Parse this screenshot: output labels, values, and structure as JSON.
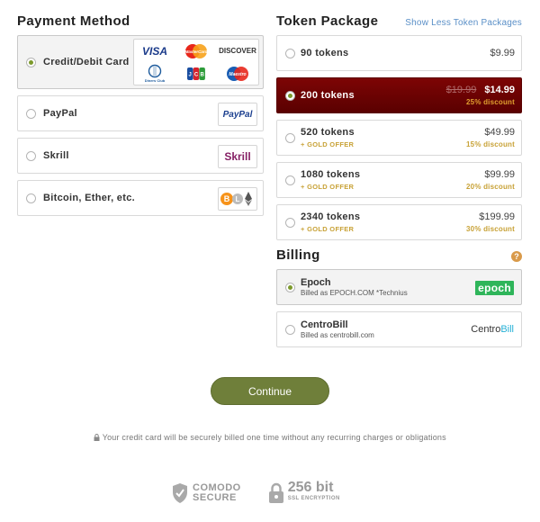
{
  "payment": {
    "title": "Payment Method",
    "methods": [
      {
        "label": "Credit/Debit Card",
        "selected": true
      },
      {
        "label": "PayPal",
        "selected": false
      },
      {
        "label": "Skrill",
        "selected": false
      },
      {
        "label": "Bitcoin, Ether, etc.",
        "selected": false
      }
    ],
    "card_logos": [
      "VISA",
      "MasterCard",
      "DISCOVER",
      "Diners Club",
      "JCB",
      "Maestro"
    ],
    "paypal_logo": "PayPal",
    "skrill_logo": "Skrill"
  },
  "tokens": {
    "title": "Token Package",
    "toggle_link": "Show Less Token Packages",
    "packages": [
      {
        "name": "90 tokens",
        "price": "$9.99",
        "offer": "",
        "discount": "",
        "old_price": "",
        "selected": false
      },
      {
        "name": "200 tokens",
        "price": "$14.99",
        "offer": "",
        "discount": "25% discount",
        "old_price": "$19.99",
        "selected": true
      },
      {
        "name": "520 tokens",
        "price": "$49.99",
        "offer": "+ GOLD OFFER",
        "discount": "15% discount",
        "old_price": "",
        "selected": false
      },
      {
        "name": "1080 tokens",
        "price": "$99.99",
        "offer": "+ GOLD OFFER",
        "discount": "20% discount",
        "old_price": "",
        "selected": false
      },
      {
        "name": "2340 tokens",
        "price": "$199.99",
        "offer": "+ GOLD OFFER",
        "discount": "30% discount",
        "old_price": "",
        "selected": false
      }
    ]
  },
  "billing": {
    "title": "Billing",
    "help": "?",
    "providers": [
      {
        "name": "Epoch",
        "sub": "Billed as EPOCH.COM *Technius",
        "logo": "epoch",
        "selected": true
      },
      {
        "name": "CentroBill",
        "sub": "Billed as centrobill.com",
        "logo_a": "Centro",
        "logo_b": "Bill",
        "selected": false
      }
    ]
  },
  "continue_label": "Continue",
  "notice": "Your credit card will be securely billed one time without any recurring charges or obligations",
  "badges": {
    "comodo_top": "COMODO",
    "comodo_bottom": "SECURE",
    "ssl_top": "256 bit",
    "ssl_bottom": "SSL ENCRYPTION"
  },
  "colors": {
    "accent_green": "#7c9a2c",
    "selected_red": "#6b0303",
    "gold": "#c8a237",
    "continue": "#6f7f3a"
  }
}
